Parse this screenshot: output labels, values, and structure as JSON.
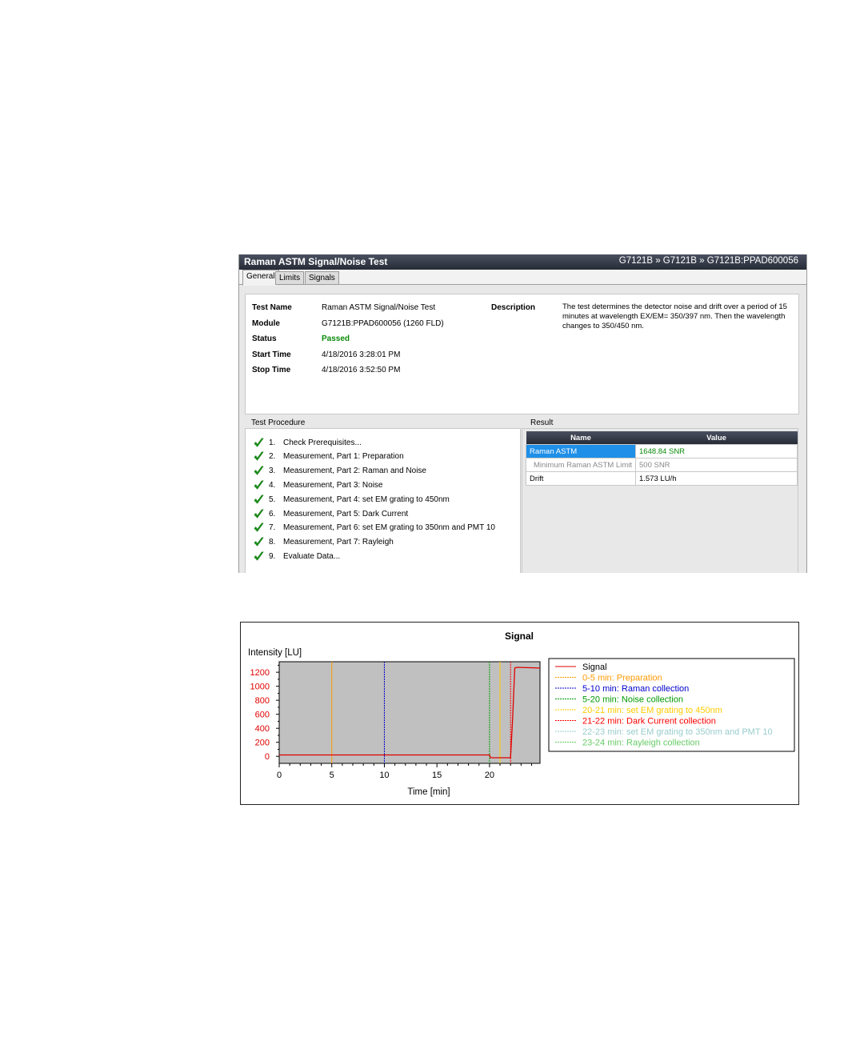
{
  "window": {
    "title": "Raman ASTM Signal/Noise Test",
    "breadcrumb": "G7121B » G7121B » G7121B:PPAD600056",
    "tabs": [
      "General",
      "Limits",
      "Signals"
    ],
    "active_tab": "General"
  },
  "general": {
    "test_name_label": "Test Name",
    "test_name": "Raman ASTM Signal/Noise Test",
    "module_label": "Module",
    "module": "G7121B:PPAD600056 (1260 FLD)",
    "status_label": "Status",
    "status": "Passed",
    "start_time_label": "Start Time",
    "start_time": "4/18/2016 3:28:01 PM",
    "stop_time_label": "Stop Time",
    "stop_time": "4/18/2016 3:52:50 PM",
    "description_label": "Description",
    "description": "The test determines the detector noise and drift over a period of 15 minutes at wavelength EX/EM= 350/397 nm. Then the wavelength changes to 350/450 nm."
  },
  "procedure": {
    "title": "Test Procedure",
    "steps": [
      {
        "num": "1.",
        "label": "Check Prerequisites..."
      },
      {
        "num": "2.",
        "label": "Measurement, Part 1: Preparation"
      },
      {
        "num": "3.",
        "label": "Measurement, Part 2: Raman and Noise"
      },
      {
        "num": "4.",
        "label": "Measurement, Part 3: Noise"
      },
      {
        "num": "5.",
        "label": "Measurement, Part 4: set EM grating to 450nm"
      },
      {
        "num": "6.",
        "label": "Measurement, Part 5: Dark Current"
      },
      {
        "num": "7.",
        "label": "Measurement, Part 6: set EM grating to 350nm and PMT 10"
      },
      {
        "num": "8.",
        "label": "Measurement, Part 7: Rayleigh"
      },
      {
        "num": "9.",
        "label": "Evaluate Data..."
      }
    ]
  },
  "result": {
    "title": "Result",
    "col_name": "Name",
    "col_value": "Value",
    "rows": [
      {
        "name": "Raman ASTM",
        "value": "1648.84 SNR"
      },
      {
        "name": "Minimum Raman ASTM Limit",
        "value": "500 SNR"
      },
      {
        "name": "Drift",
        "value": "1.573 LU/h"
      }
    ]
  },
  "chart_data": {
    "type": "line",
    "title": "Signal",
    "ylabel": "Intensity [LU]",
    "xlabel": "Time [min]",
    "xlim": [
      0,
      24.8
    ],
    "ylim": [
      -100,
      1350
    ],
    "xticks": [
      0,
      5,
      10,
      15,
      20
    ],
    "yticks": [
      0,
      200,
      400,
      600,
      800,
      1000,
      1200
    ],
    "grid": false,
    "legend_position": "right",
    "series": [
      {
        "name": "Signal",
        "color": "#e00000",
        "x": [
          0,
          20.0,
          20.1,
          22.0,
          22.2,
          22.4,
          22.6,
          24.8
        ],
        "y": [
          20,
          20,
          -20,
          -20,
          550,
          1260,
          1270,
          1260
        ]
      }
    ],
    "markers": [
      {
        "label": "0-5 min: Preparation",
        "x": 5,
        "color": "#ff9900"
      },
      {
        "label": "5-10 min: Raman collection",
        "x": 10,
        "color": "#0000cc"
      },
      {
        "label": "5-20 min: Noise collection",
        "x": 20,
        "color": "#009900"
      },
      {
        "label": "20-21 min: set EM grating to 450nm",
        "x": 21,
        "color": "#ffcc00"
      },
      {
        "label": "21-22 min: Dark Current collection",
        "x": 22,
        "color": "#ff0000"
      },
      {
        "label": "22-23 min: set EM grating to 350nm and PMT 10",
        "x": 23,
        "color": "#99cccc"
      },
      {
        "label": "23-24 min: Rayleigh collection",
        "x": 24,
        "color": "#66cc66"
      }
    ]
  }
}
